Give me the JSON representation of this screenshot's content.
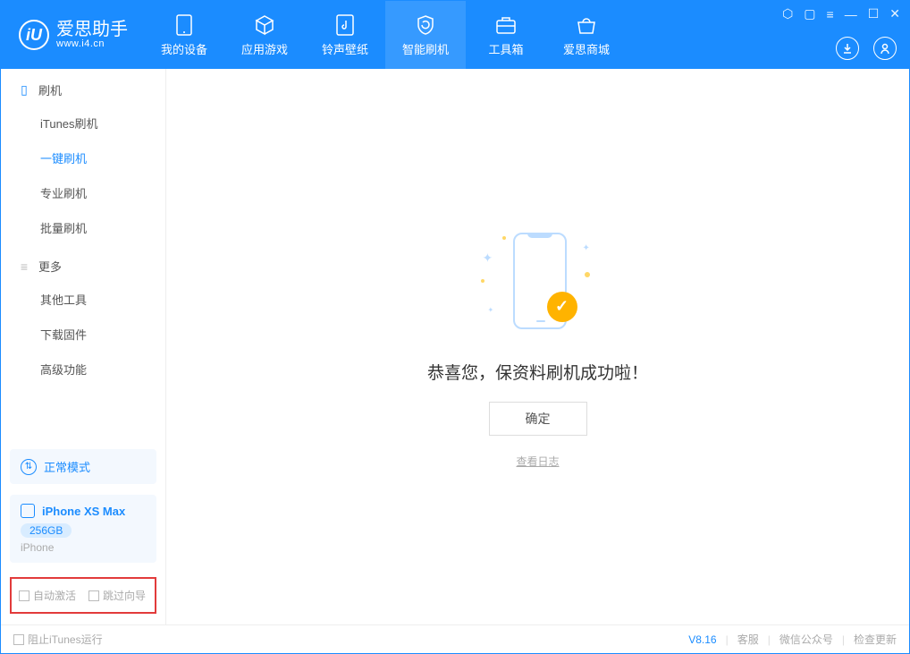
{
  "app": {
    "name": "爱思助手",
    "url": "www.i4.cn"
  },
  "nav": {
    "items": [
      {
        "label": "我的设备"
      },
      {
        "label": "应用游戏"
      },
      {
        "label": "铃声壁纸"
      },
      {
        "label": "智能刷机"
      },
      {
        "label": "工具箱"
      },
      {
        "label": "爱思商城"
      }
    ],
    "active_index": 3
  },
  "sidebar": {
    "group1_title": "刷机",
    "group1": [
      {
        "label": "iTunes刷机"
      },
      {
        "label": "一键刷机"
      },
      {
        "label": "专业刷机"
      },
      {
        "label": "批量刷机"
      }
    ],
    "group1_active_index": 1,
    "group2_title": "更多",
    "group2": [
      {
        "label": "其他工具"
      },
      {
        "label": "下载固件"
      },
      {
        "label": "高级功能"
      }
    ],
    "mode_label": "正常模式",
    "device": {
      "name": "iPhone XS Max",
      "capacity": "256GB",
      "type": "iPhone"
    },
    "checkbox_a": "自动激活",
    "checkbox_b": "跳过向导"
  },
  "main": {
    "success_text": "恭喜您，保资料刷机成功啦！",
    "ok_button": "确定",
    "log_link": "查看日志"
  },
  "footer": {
    "block_itunes": "阻止iTunes运行",
    "version": "V8.16",
    "links": [
      "客服",
      "微信公众号",
      "检查更新"
    ]
  }
}
